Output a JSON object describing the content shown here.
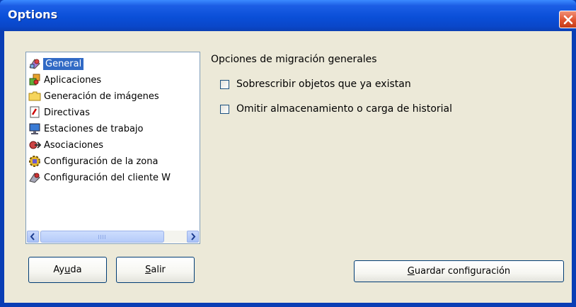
{
  "window": {
    "title": "Options"
  },
  "sidebar": {
    "items": [
      {
        "label": "General",
        "icon": "general-icon",
        "selected": true
      },
      {
        "label": "Aplicaciones",
        "icon": "applications-icon",
        "selected": false
      },
      {
        "label": "Generación de imágenes",
        "icon": "folder-icon",
        "selected": false
      },
      {
        "label": "Directivas",
        "icon": "policies-icon",
        "selected": false
      },
      {
        "label": "Estaciones de trabajo",
        "icon": "workstation-icon",
        "selected": false
      },
      {
        "label": "Asociaciones",
        "icon": "associations-icon",
        "selected": false
      },
      {
        "label": "Configuración de la zona",
        "icon": "zone-config-icon",
        "selected": false
      },
      {
        "label": "Configuración del cliente W",
        "icon": "client-config-icon",
        "selected": false
      }
    ]
  },
  "main": {
    "heading": "Opciones de migración generales",
    "options": [
      {
        "label": "Sobrescribir objetos que ya existan",
        "checked": false
      },
      {
        "label": "Omitir almacenamiento o carga de historial",
        "checked": false
      }
    ]
  },
  "buttons": {
    "help": {
      "pre": "Ay",
      "mnemonic": "u",
      "post": "da"
    },
    "exit": {
      "pre": "",
      "mnemonic": "S",
      "post": "alir"
    },
    "save": {
      "pre": "",
      "mnemonic": "G",
      "post": "uardar configuración"
    }
  },
  "colors": {
    "titlebar": "#0a4fd8",
    "selection": "#316ac5",
    "face": "#ece9d8",
    "close": "#e0532f"
  }
}
